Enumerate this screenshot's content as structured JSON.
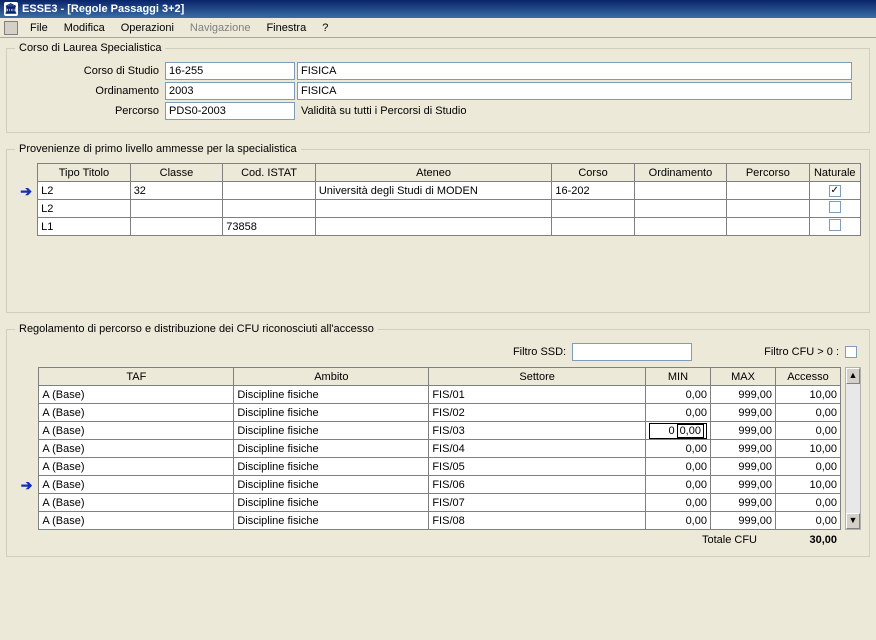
{
  "title": "ESSE3 - [Regole Passaggi 3+2]",
  "menu": {
    "file": "File",
    "modifica": "Modifica",
    "operazioni": "Operazioni",
    "navigazione": "Navigazione",
    "finestra": "Finestra",
    "help": "?"
  },
  "group1": {
    "legend": "Corso di Laurea Specialistica",
    "corso_label": "Corso di Studio",
    "corso_code": "16-255",
    "corso_desc": "FISICA",
    "ord_label": "Ordinamento",
    "ord_code": "2003",
    "ord_desc": "FISICA",
    "perc_label": "Percorso",
    "perc_code": "PDS0-2003",
    "perc_desc": "Validità su tutti i Percorsi di Studio"
  },
  "group2": {
    "legend": "Provenienze di primo livello ammesse per la specialistica",
    "headers": {
      "tipo": "Tipo Titolo",
      "classe": "Classe",
      "istat": "Cod. ISTAT",
      "ateneo": "Ateneo",
      "corso": "Corso",
      "ord": "Ordinamento",
      "perc": "Percorso",
      "nat": "Naturale"
    },
    "rows": [
      {
        "sel": true,
        "tipo": "L2",
        "classe": "32",
        "istat": "",
        "ateneo": "Università degli Studi di MODEN",
        "corso": "16-202",
        "ord": "",
        "perc": "",
        "nat": true
      },
      {
        "sel": false,
        "tipo": "L2",
        "classe": "",
        "istat": "",
        "ateneo": "",
        "corso": "",
        "ord": "",
        "perc": "",
        "nat": false
      },
      {
        "sel": false,
        "tipo": "L1",
        "classe": "",
        "istat": "73858",
        "ateneo": "",
        "corso": "",
        "ord": "",
        "perc": "",
        "nat": false
      }
    ]
  },
  "group3": {
    "legend": "Regolamento di percorso e distribuzione dei CFU riconosciuti all'accesso",
    "filter_ssd_label": "Filtro SSD:",
    "filter_cfu_label": "Filtro CFU > 0 :",
    "headers": {
      "taf": "TAF",
      "ambito": "Ambito",
      "settore": "Settore",
      "min": "MIN",
      "max": "MAX",
      "accesso": "Accesso"
    },
    "rows": [
      {
        "sel": false,
        "taf": "A  (Base)",
        "ambito": "Discipline fisiche",
        "settore": "FIS/01",
        "min": "0,00",
        "max": "999,00",
        "accesso": "10,00",
        "editMin": ""
      },
      {
        "sel": false,
        "taf": "A  (Base)",
        "ambito": "Discipline fisiche",
        "settore": "FIS/02",
        "min": "0,00",
        "max": "999,00",
        "accesso": "0,00",
        "editMin": ""
      },
      {
        "sel": false,
        "taf": "A  (Base)",
        "ambito": "Discipline fisiche",
        "settore": "FIS/03",
        "min": "0",
        "max": "999,00",
        "accesso": "0,00",
        "editMin": "0,00"
      },
      {
        "sel": false,
        "taf": "A  (Base)",
        "ambito": "Discipline fisiche",
        "settore": "FIS/04",
        "min": "0,00",
        "max": "999,00",
        "accesso": "10,00",
        "editMin": ""
      },
      {
        "sel": false,
        "taf": "A  (Base)",
        "ambito": "Discipline fisiche",
        "settore": "FIS/05",
        "min": "0,00",
        "max": "999,00",
        "accesso": "0,00",
        "editMin": ""
      },
      {
        "sel": true,
        "taf": "A  (Base)",
        "ambito": "Discipline fisiche",
        "settore": "FIS/06",
        "min": "0,00",
        "max": "999,00",
        "accesso": "10,00",
        "editMin": ""
      },
      {
        "sel": false,
        "taf": "A  (Base)",
        "ambito": "Discipline fisiche",
        "settore": "FIS/07",
        "min": "0,00",
        "max": "999,00",
        "accesso": "0,00",
        "editMin": ""
      },
      {
        "sel": false,
        "taf": "A  (Base)",
        "ambito": "Discipline fisiche",
        "settore": "FIS/08",
        "min": "0,00",
        "max": "999,00",
        "accesso": "0,00",
        "editMin": ""
      }
    ],
    "totale_label": "Totale CFU",
    "totale_value": "30,00"
  }
}
